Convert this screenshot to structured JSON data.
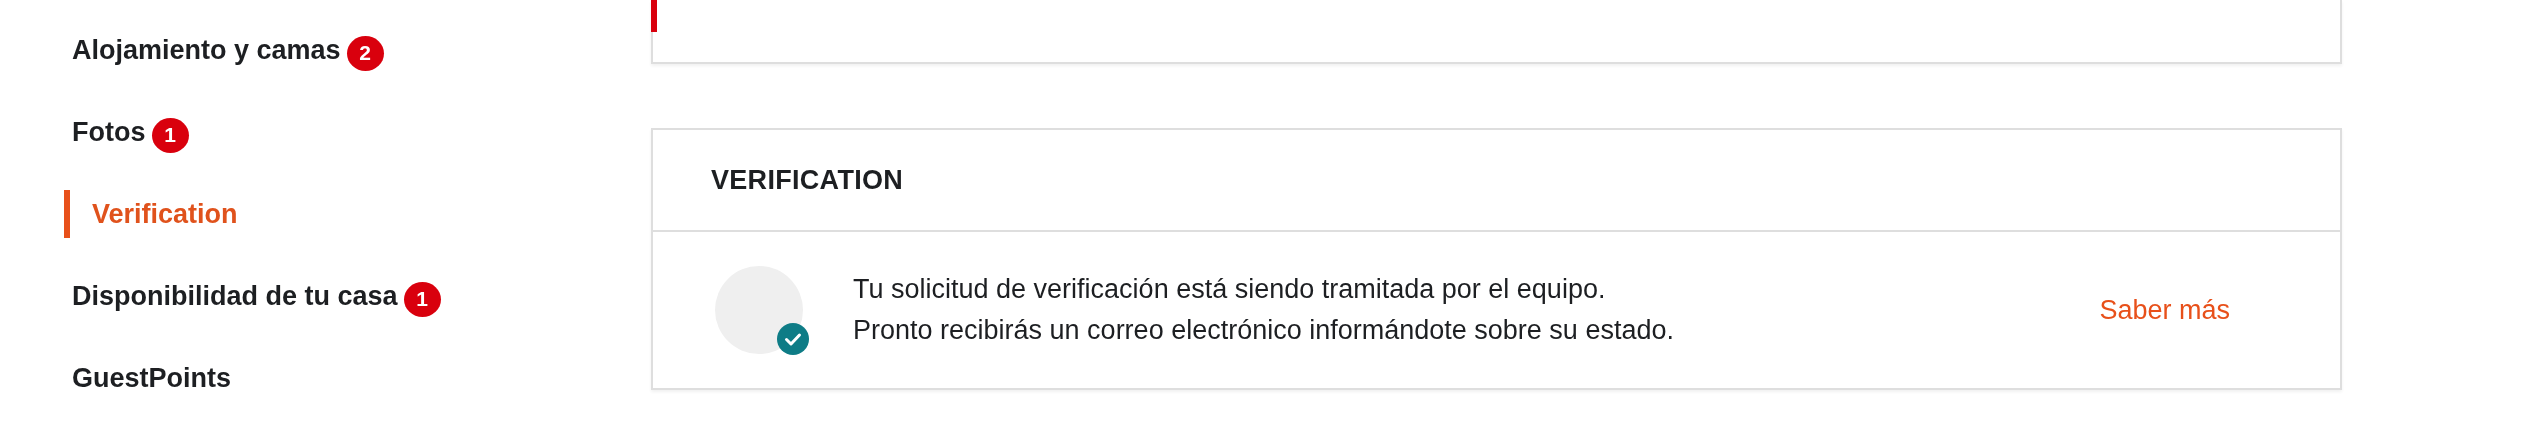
{
  "sidebar": {
    "items": [
      {
        "label": "Alojamiento y camas",
        "badge": "2",
        "selected": false
      },
      {
        "label": "Fotos",
        "badge": "1",
        "selected": false
      },
      {
        "label": "Verification",
        "selected": true
      },
      {
        "label": "Disponibilidad de tu casa",
        "badge": "1",
        "selected": false
      },
      {
        "label": "GuestPoints",
        "selected": false
      }
    ]
  },
  "verification": {
    "title": "VERIFICATION",
    "verified": true,
    "message_lines": [
      "Tu solicitud de verificación está siendo tramitada por el equipo.",
      "Pronto recibirás un correo electrónico informándote sobre su estado."
    ],
    "link": "Saber más"
  }
}
